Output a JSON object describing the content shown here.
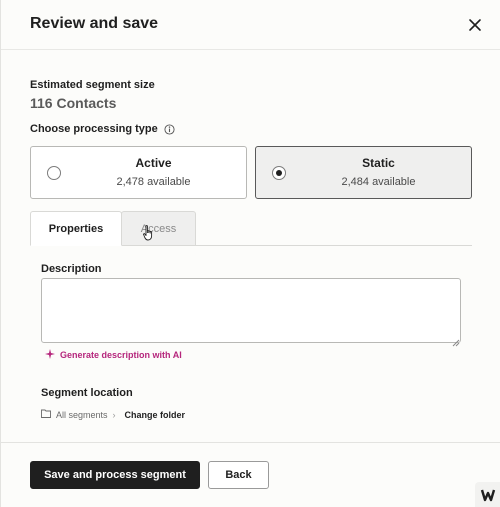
{
  "header": {
    "title": "Review and save",
    "close_icon": "close-icon"
  },
  "estimate": {
    "label": "Estimated segment size",
    "value": "116 Contacts"
  },
  "processing": {
    "label": "Choose processing type",
    "info_icon": "info-icon",
    "options": [
      {
        "title": "Active",
        "subtitle": "2,478 available",
        "selected": false
      },
      {
        "title": "Static",
        "subtitle": "2,484 available",
        "selected": true
      }
    ]
  },
  "tabs": [
    {
      "label": "Properties",
      "selected": true
    },
    {
      "label": "Access",
      "selected": false
    }
  ],
  "description": {
    "label": "Description",
    "value": "",
    "ai_link": "Generate description with AI",
    "ai_icon": "sparkle-icon"
  },
  "location": {
    "label": "Segment location",
    "folder_icon": "folder-icon",
    "path": "All segments",
    "change": "Change folder"
  },
  "footer": {
    "primary": "Save and process segment",
    "secondary": "Back"
  },
  "colors": {
    "accent_ai": "#b5267c",
    "primary_button": "#1f1f1f"
  }
}
